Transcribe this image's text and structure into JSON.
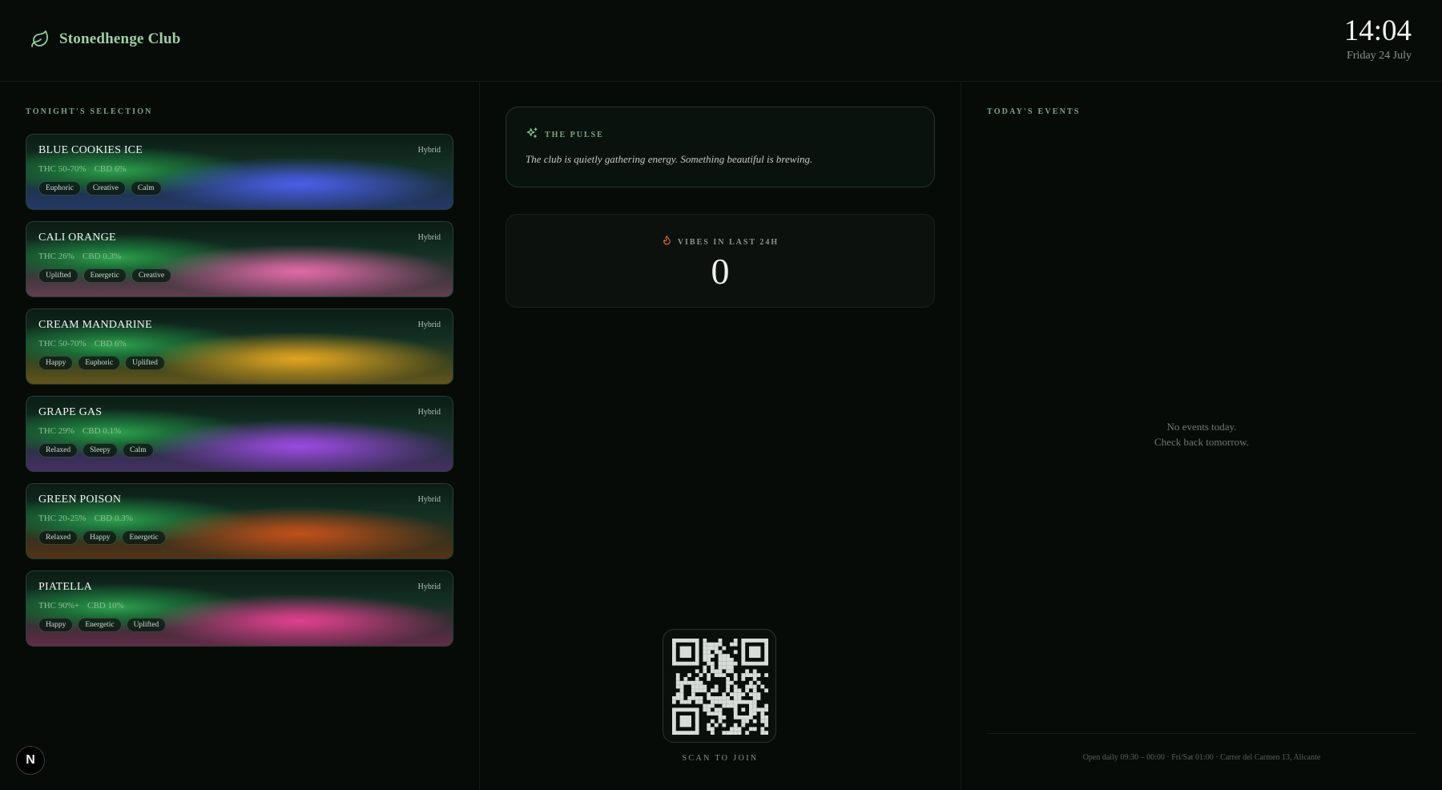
{
  "header": {
    "brand_icon": "leaf-icon",
    "brand_name": "Stonedhenge Club",
    "time": "14:04",
    "date": "Friday 24 July"
  },
  "left": {
    "section_title": "TONIGHT'S SELECTION",
    "strains": [
      {
        "name": "BLUE COOKIES ICE",
        "type": "Hybrid",
        "thc": "THC 50-70%",
        "cbd": "CBD 6%",
        "tags": [
          "Euphoric",
          "Creative",
          "Calm"
        ],
        "color": "#4a5ee8"
      },
      {
        "name": "CALI ORANGE",
        "type": "Hybrid",
        "thc": "THC 26%",
        "cbd": "CBD 0.3%",
        "tags": [
          "Uplifted",
          "Energetic",
          "Creative"
        ],
        "color": "#e06aa8"
      },
      {
        "name": "CREAM MANDARINE",
        "type": "Hybrid",
        "thc": "THC 50-70%",
        "cbd": "CBD 6%",
        "tags": [
          "Happy",
          "Euphoric",
          "Uplifted"
        ],
        "color": "#e0a520"
      },
      {
        "name": "GRAPE GAS",
        "type": "Hybrid",
        "thc": "THC 29%",
        "cbd": "CBD 0.1%",
        "tags": [
          "Relaxed",
          "Sleepy",
          "Calm"
        ],
        "color": "#9a4ae0"
      },
      {
        "name": "GREEN POISON",
        "type": "Hybrid",
        "thc": "THC 20-25%",
        "cbd": "CBD 0.3%",
        "tags": [
          "Relaxed",
          "Happy",
          "Energetic"
        ],
        "color": "#c0501a"
      },
      {
        "name": "PIATELLA",
        "type": "Hybrid",
        "thc": "THC 90%+",
        "cbd": "CBD 10%",
        "tags": [
          "Happy",
          "Energetic",
          "Uplifted"
        ],
        "color": "#e0408f"
      }
    ]
  },
  "middle": {
    "pulse": {
      "icon": "sparkles-icon",
      "title": "THE PULSE",
      "text": "The club is quietly gathering energy. Something beautiful is brewing."
    },
    "vibes": {
      "icon": "flame-icon",
      "title": "VIBES IN LAST 24H",
      "count": "0"
    },
    "qr": {
      "icon": "qr-code-icon",
      "label": "SCAN TO JOIN"
    }
  },
  "right": {
    "section_title": "TODAY'S EVENTS",
    "empty_line1": "No events today.",
    "empty_line2": "Check back tomorrow.",
    "footer": "Open daily 09:30 – 00:00 · Fri/Sat 01:00 · Carrer del Carmen 13, Alicante"
  },
  "badge": {
    "letter": "N"
  }
}
